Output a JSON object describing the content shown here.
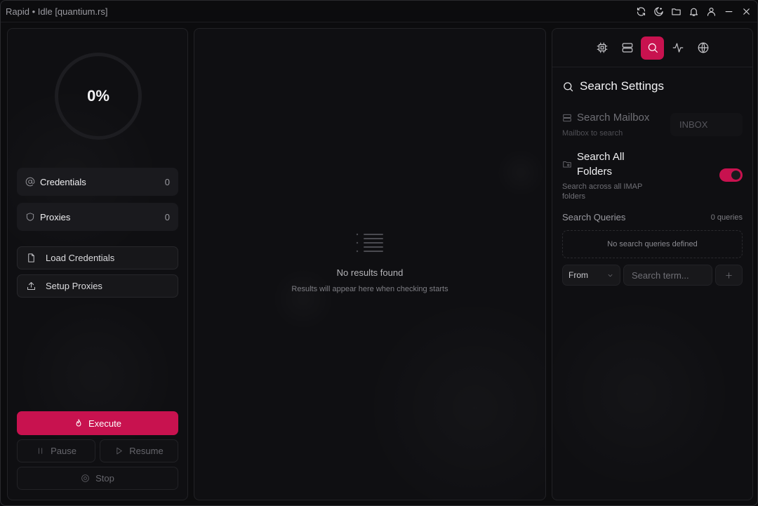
{
  "window": {
    "title": "Rapid • Idle [quantium.rs]"
  },
  "titlebar_icons": [
    "refresh-icon",
    "theme-moon-icon",
    "folder-icon",
    "bell-icon",
    "user-icon",
    "minimize-icon",
    "close-icon"
  ],
  "left": {
    "progress": {
      "text": "0%",
      "fraction": 0
    },
    "stats": [
      {
        "label": "Credentials",
        "value": "0",
        "icon": "at-icon"
      },
      {
        "label": "Proxies",
        "value": "0",
        "icon": "shield-icon"
      }
    ],
    "actions": [
      {
        "label": "Load Credentials",
        "icon": "file-icon"
      },
      {
        "label": "Setup Proxies",
        "icon": "upload-icon"
      }
    ],
    "execute_label": "Execute",
    "pause_label": "Pause",
    "resume_label": "Resume",
    "stop_label": "Stop"
  },
  "center": {
    "empty_title": "No results found",
    "empty_subtitle": "Results will appear here when checking starts"
  },
  "right": {
    "tabs": [
      {
        "icon": "cpu-icon",
        "active": false
      },
      {
        "icon": "server-icon",
        "active": false
      },
      {
        "icon": "search-icon",
        "active": true
      },
      {
        "icon": "activity-icon",
        "active": false
      },
      {
        "icon": "globe-icon",
        "active": false
      }
    ],
    "heading": "Search Settings",
    "mailbox": {
      "title": "Search Mailbox",
      "description": "Mailbox to search",
      "value": "INBOX"
    },
    "all_folders": {
      "title_line1": "Search All",
      "title_line2": "Folders",
      "description_line1": "Search across all IMAP",
      "description_line2": "folders",
      "enabled": true
    },
    "queries": {
      "label": "Search Queries",
      "count": "0 queries",
      "empty": "No search queries defined",
      "field_select": "From",
      "term_placeholder": "Search term...",
      "add_symbol": "+"
    }
  },
  "colors": {
    "accent": "#c8124f",
    "background": "#0c0c0e",
    "panel": "#0f0f12"
  }
}
